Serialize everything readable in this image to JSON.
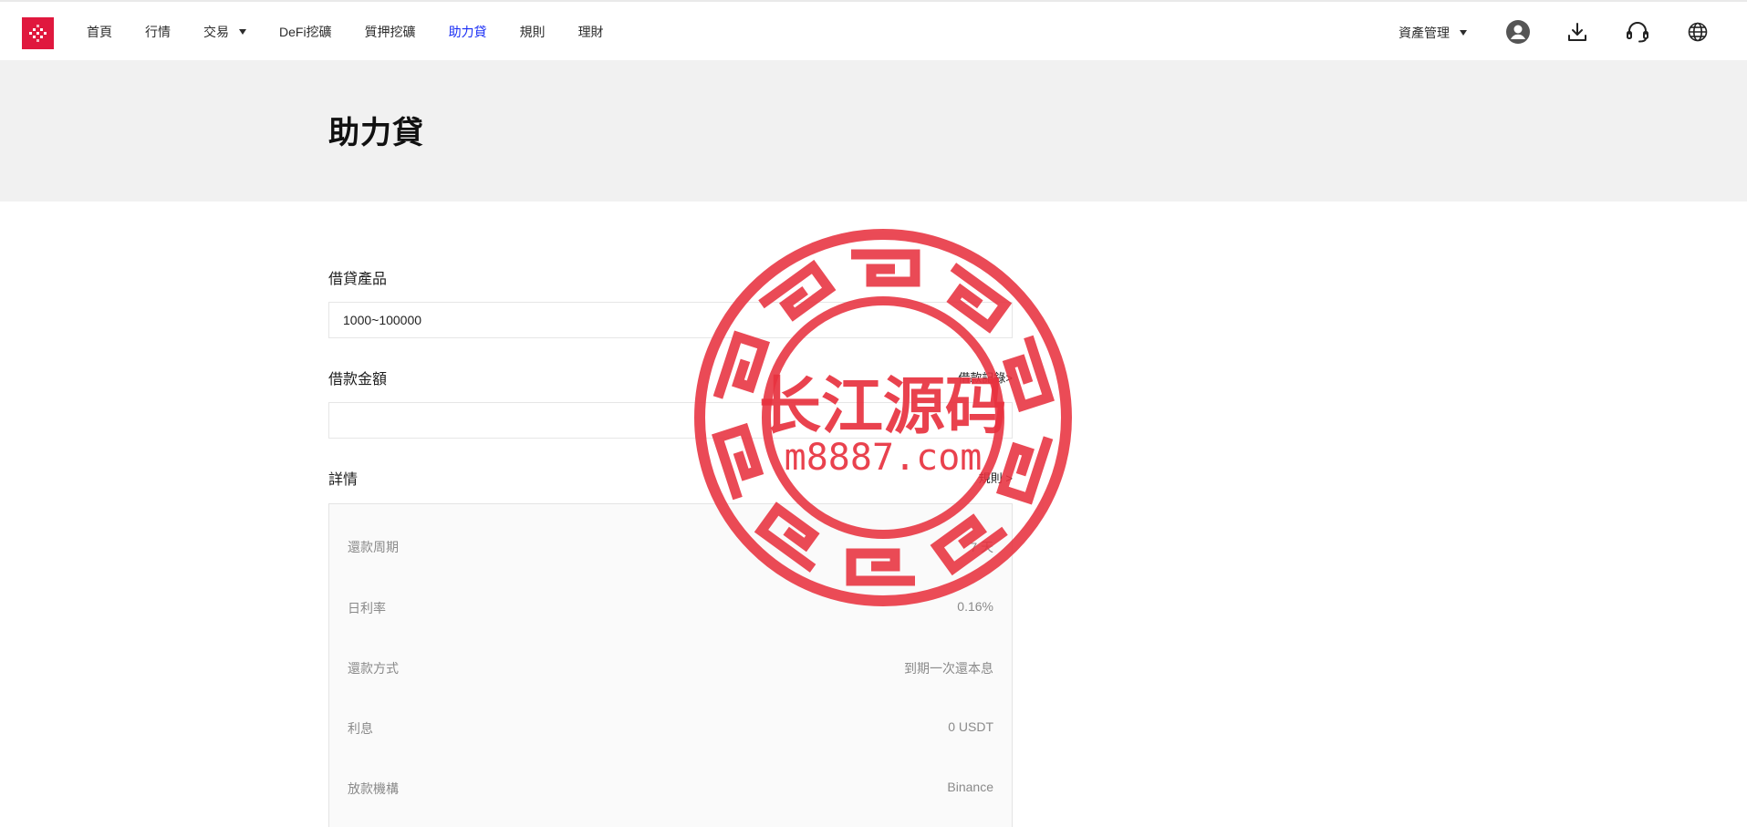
{
  "nav": {
    "items": [
      {
        "label": "首頁"
      },
      {
        "label": "行情"
      },
      {
        "label": "交易",
        "dropdown": true
      },
      {
        "label": "DeFi挖礦"
      },
      {
        "label": "質押挖礦"
      },
      {
        "label": "助力貸",
        "active": true
      },
      {
        "label": "規則"
      },
      {
        "label": "理財"
      }
    ],
    "asset_management": "資產管理",
    "icons": [
      "user-icon",
      "download-icon",
      "headset-icon",
      "globe-icon"
    ]
  },
  "page": {
    "title": "助力貸"
  },
  "form": {
    "product_label": "借貸產品",
    "product_value": "1000~100000",
    "amount_label": "借款金額",
    "amount_value": "",
    "records_link": "借款記錄>",
    "details_label": "詳情",
    "rules_link": "規則 >"
  },
  "details": {
    "rows": [
      {
        "label": "還款周期",
        "value": "7 天"
      },
      {
        "label": "日利率",
        "value": "0.16%"
      },
      {
        "label": "還款方式",
        "value": "到期一次還本息"
      },
      {
        "label": "利息",
        "value": "0 USDT"
      },
      {
        "label": "放款機構",
        "value": "Binance"
      }
    ]
  },
  "watermark": {
    "line1": "长江源码",
    "line2": "m8887.com"
  },
  "colors": {
    "brand": "#e0183e",
    "active_nav": "#1a2ef5",
    "watermark": "#e8323f"
  }
}
